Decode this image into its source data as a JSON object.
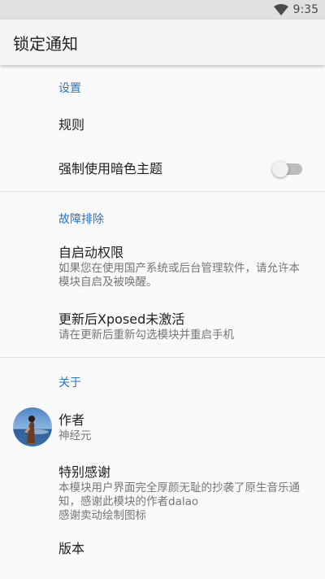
{
  "status_bar": {
    "time": "9:35",
    "wifi_icon": "wifi-icon"
  },
  "app_bar": {
    "title": "锁定通知"
  },
  "sections": {
    "settings": {
      "header": "设置",
      "rules_title": "规则",
      "dark_theme_title": "强制使用暗色主题",
      "dark_theme_on": false
    },
    "troubleshoot": {
      "header": "故障排除",
      "autostart_title": "自启动权限",
      "autostart_summary": "如果您在使用国产系统或后台管理软件，请允许本模块自启及被唤醒。",
      "xposed_title": "更新后Xposed未激活",
      "xposed_summary": "请在更新后重新勾选模块并重启手机"
    },
    "about": {
      "header": "关于",
      "author_title": "作者",
      "author_name": "神经元",
      "thanks_title": "特别感谢",
      "thanks_line1": "本模块用户界面完全厚颜无耻的抄袭了原生音乐通知，感谢此模块的作者dalao",
      "thanks_line2": "感谢卖动绘制图标",
      "version_title": "版本"
    }
  },
  "colors": {
    "accent": "#2a74c0",
    "primary_text": "#212121",
    "secondary_text": "#757575"
  }
}
